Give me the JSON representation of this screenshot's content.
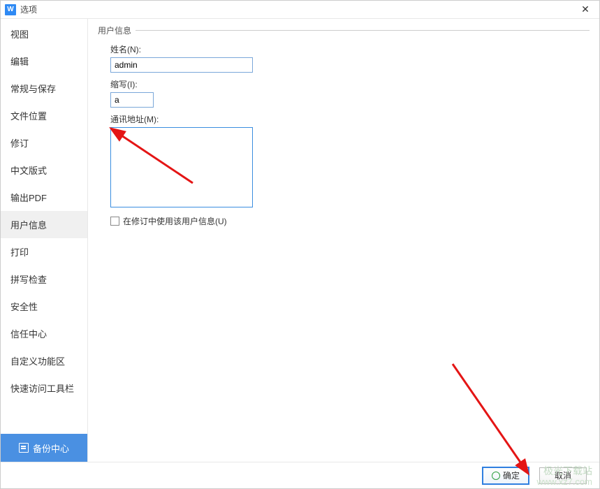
{
  "titlebar": {
    "app_icon_text": "W",
    "title": "选项"
  },
  "sidebar": {
    "items": [
      {
        "label": "视图"
      },
      {
        "label": "编辑"
      },
      {
        "label": "常规与保存"
      },
      {
        "label": "文件位置"
      },
      {
        "label": "修订"
      },
      {
        "label": "中文版式"
      },
      {
        "label": "输出PDF"
      },
      {
        "label": "用户信息",
        "selected": true
      },
      {
        "label": "打印"
      },
      {
        "label": "拼写检查"
      },
      {
        "label": "安全性"
      },
      {
        "label": "信任中心"
      },
      {
        "label": "自定义功能区"
      },
      {
        "label": "快速访问工具栏"
      }
    ],
    "backup_label": "备份中心"
  },
  "content": {
    "legend": "用户信息",
    "name_label": "姓名(N):",
    "name_value": "admin",
    "initials_label": "缩写(I):",
    "initials_value": "a",
    "address_label": "通讯地址(M):",
    "address_value": "",
    "checkbox_label": "在修订中使用该用户信息(U)",
    "checkbox_checked": false
  },
  "footer": {
    "ok": "确定",
    "cancel": "取消"
  },
  "watermark": {
    "line1": "极光下载站",
    "line2": "www.xz7.com"
  }
}
